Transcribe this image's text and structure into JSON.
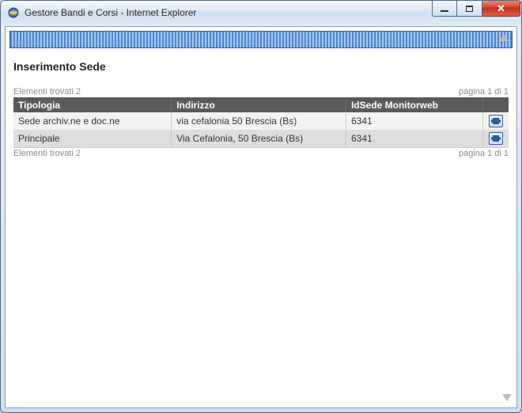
{
  "window": {
    "title": "Gestore Bandi e Corsi - Internet Explorer"
  },
  "page": {
    "heading": "Inserimento Sede",
    "elements_found_top": "Elementi trovati 2",
    "elements_found_bottom": "Elementi trovati 2",
    "pagination_top": "pagina 1 di 1",
    "pagination_bottom": "pagina 1 di 1"
  },
  "table": {
    "headers": {
      "tipologia": "Tipologia",
      "indirizzo": "Indirizzo",
      "idsede": "IdSede Monitorweb",
      "action": ""
    },
    "rows": [
      {
        "tipologia": "Sede archiv.ne e doc.ne",
        "indirizzo": "via cefalonia 50 Brescia (Bs)",
        "idsede": "6341"
      },
      {
        "tipologia": "Principale",
        "indirizzo": "Via Cefalonia, 50 Brescia (Bs)",
        "idsede": "6341"
      }
    ]
  }
}
